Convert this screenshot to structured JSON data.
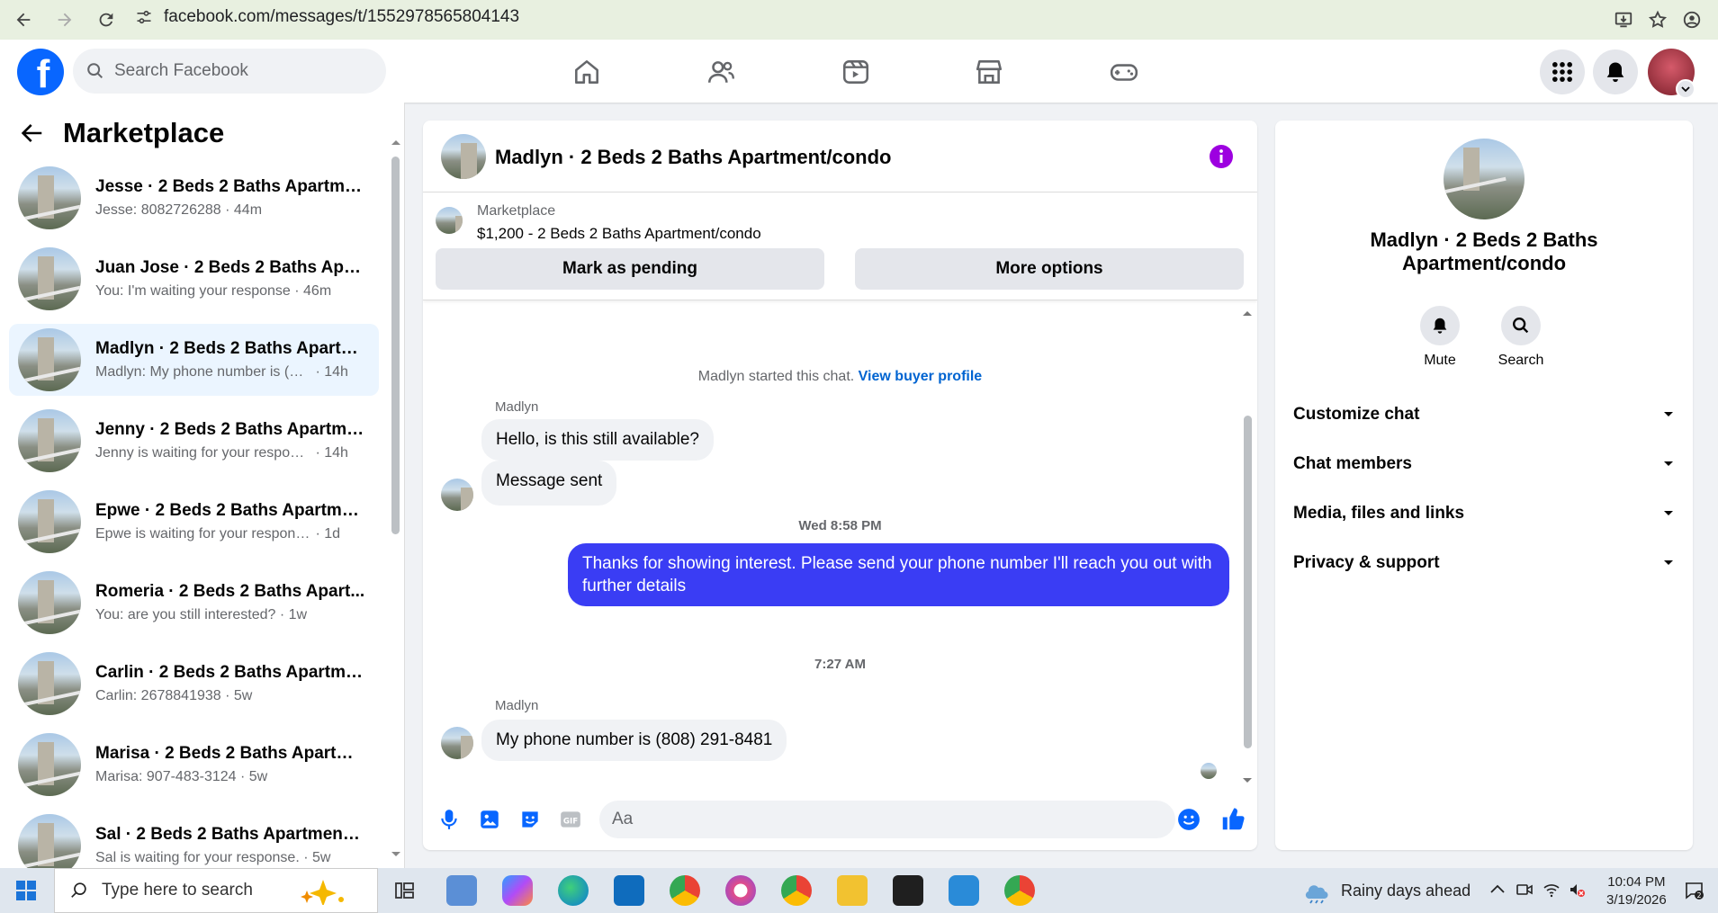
{
  "browser": {
    "url": "facebook.com/messages/t/1552978565804143"
  },
  "header": {
    "search_placeholder": "Search Facebook"
  },
  "left_panel": {
    "title": "Marketplace",
    "conversations": [
      {
        "name": "Jesse · 2 Beds 2 Baths Apartmen...",
        "message": "Jesse: 8082726288",
        "time": "44m"
      },
      {
        "name": "Juan Jose · 2 Beds 2 Baths Apart...",
        "message": "You: I'm waiting your response",
        "time": "46m"
      },
      {
        "name": "Madlyn · 2 Beds 2 Baths Apartm...",
        "message": "Madlyn: My phone number is (80...",
        "time": "14h"
      },
      {
        "name": "Jenny · 2 Beds 2 Baths Apartme...",
        "message": "Jenny is waiting for your response.",
        "time": "14h"
      },
      {
        "name": "Epwe · 2 Beds 2 Baths Apartmen...",
        "message": "Epwe is waiting for your response.",
        "time": "1d"
      },
      {
        "name": "Romeria · 2 Beds 2 Baths Apart...",
        "message": "You: are you still interested?",
        "time": "1w"
      },
      {
        "name": "Carlin · 2 Beds 2 Baths Apartme...",
        "message": "Carlin: 2678841938",
        "time": "5w"
      },
      {
        "name": "Marisa · 2 Beds 2 Baths Apartme...",
        "message": "Marisa: 907-483-3124",
        "time": "5w"
      },
      {
        "name": "Sal · 2 Beds 2 Baths Apartment/...",
        "message": "Sal is waiting for your response.",
        "time": "5w"
      }
    ]
  },
  "chat": {
    "title": "Madlyn · 2 Beds 2 Baths Apartment/condo",
    "marketplace_label": "Marketplace",
    "listing": "$1,200 - 2 Beds 2 Baths Apartment/condo",
    "mark_pending": "Mark as pending",
    "more_options": "More options",
    "system_text": "Madlyn started this chat.",
    "view_profile": "View buyer profile",
    "sender_1": "Madlyn",
    "msg_1": "Hello, is this still available?",
    "msg_2": "Message sent",
    "ts_1": "Wed 8:58 PM",
    "msg_out": "Thanks for showing interest. Please send your phone number  I'll reach you out with further details",
    "ts_2": "7:27 AM",
    "sender_2": "Madlyn",
    "msg_3": "My phone number is (808) 291-8481",
    "input_placeholder": "Aa"
  },
  "right_panel": {
    "title": "Madlyn · 2 Beds 2 Baths Apartment/condo",
    "mute": "Mute",
    "search": "Search",
    "sections": [
      "Customize chat",
      "Chat members",
      "Media, files and links",
      "Privacy & support"
    ]
  },
  "taskbar": {
    "search_placeholder": "Type here to search",
    "weather": "Rainy days ahead",
    "time": "10:04 PM",
    "date": "3/19/2026"
  }
}
